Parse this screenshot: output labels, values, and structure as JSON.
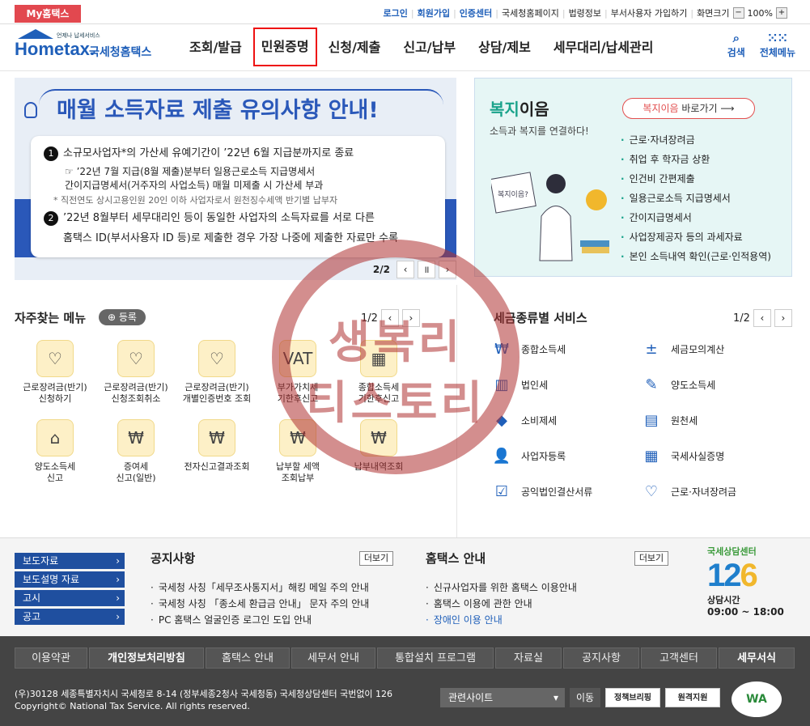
{
  "topbar": {
    "my_label": "My홈택스",
    "links": [
      "로그인",
      "회원가입",
      "인증센터",
      "국세청홈페이지",
      "법령정보",
      "부서사용자 가입하기",
      "화면크기"
    ],
    "zoom": "100%"
  },
  "header": {
    "logo_small": "언제나 납세서비스",
    "logo_main": "Hometax.",
    "logo_kr": "국세청홈택스",
    "nav": [
      "조회/발급",
      "민원증명",
      "신청/제출",
      "신고/납부",
      "상담/제보",
      "세무대리/납세관리"
    ],
    "search_label": "검색",
    "menu_label": "전체메뉴"
  },
  "banner": {
    "title": "매월 소득자료 제출 유의사항 안내!",
    "item1_num": "1",
    "item1": "소규모사업자*의 가산세 유예기간이 ’22년 6월 지급분까지로 종료",
    "item1_sub1": "’22년 7월 지급(8월 제출)분부터 일용근로소득 지급명세서",
    "item1_sub2": "간이지급명세서(거주자의 사업소득) 매월 미제출 시 가산세 부과",
    "item1_note": "* 직전연도 상시고용인원 20인 이하 사업자로서 원천징수세액 반기별 납부자",
    "item2_num": "2",
    "item2a": "’22년 8월부터 세무대리인 등이 동일한 사업자의 소득자료를 서로 다른",
    "item2b": "홈택스 ID(부서사용자 ID 등)로 제출한 경우 가장 나중에 제출한 자료만 수록",
    "page": "2/2"
  },
  "welfare": {
    "title_green": "복지",
    "title_rest": "이음",
    "subtitle": "소득과 복지를 연결하다!",
    "go_red": "복지이음",
    "go_rest": " 바로가기",
    "items": [
      "근로·자녀장려금",
      "취업 후 학자금 상환",
      "인건비 간편제출",
      "일용근로소득 지급명세서",
      "간이지급명세서",
      "사업장제공자 등의 과세자료",
      "본인 소득내역 확인(근로·인적용역)"
    ],
    "ill_text": "복지이음?"
  },
  "favorites": {
    "title": "자주찾는 메뉴",
    "register": "등록",
    "page": "1/2",
    "items": [
      {
        "label": "근로장려금(반기)\n신청하기",
        "icon": "♡"
      },
      {
        "label": "근로장려금(반기)\n신청조회취소",
        "icon": "♡"
      },
      {
        "label": "근로장려금(반기)\n개별인증번호 조회",
        "icon": "♡"
      },
      {
        "label": "부가가치세\n기한후신고",
        "icon": "VAT"
      },
      {
        "label": "종합소득세\n기한후신고",
        "icon": "▦"
      },
      {
        "label": "양도소득세\n신고",
        "icon": "⌂"
      },
      {
        "label": "증여세\n신고(일반)",
        "icon": "₩"
      },
      {
        "label": "전자신고결과조회",
        "icon": "₩"
      },
      {
        "label": "납부할 세액\n조회납부",
        "icon": "₩"
      },
      {
        "label": "납부내역조회",
        "icon": "₩"
      }
    ]
  },
  "taxservice": {
    "title": "세금종류별 서비스",
    "page": "1/2",
    "items": [
      {
        "label": "종합소득세",
        "icon": "₩"
      },
      {
        "label": "세금모의계산",
        "icon": "±"
      },
      {
        "label": "법인세",
        "icon": "▥"
      },
      {
        "label": "양도소득세",
        "icon": "✎"
      },
      {
        "label": "소비제세",
        "icon": "◆"
      },
      {
        "label": "원천세",
        "icon": "▤"
      },
      {
        "label": "사업자등록",
        "icon": "👤"
      },
      {
        "label": "국세사실증명",
        "icon": "▦"
      },
      {
        "label": "공익법인결산서류",
        "icon": "☑"
      },
      {
        "label": "근로·자녀장려금",
        "icon": "♡"
      }
    ]
  },
  "notice": {
    "side_buttons": [
      "보도자료",
      "보도설명 자료",
      "고시",
      "공고"
    ],
    "notice_title": "공지사항",
    "more": "더보기",
    "notices": [
      "국세청 사칭「세무조사통지서」해킹 메일 주의 안내",
      "국세청 사칭 「종소세 환급금 안내」 문자 주의 안내",
      "PC 홈택스 얼굴인증 로그인 도입 안내"
    ],
    "guide_title": "홈택스 안내",
    "guides": [
      "신규사업자를 위한 홈택스 이용안내",
      "홈택스 이용에 관한 안내",
      "장애인 이용 안내"
    ],
    "center_label": "국세상담센터",
    "center_num_a": "12",
    "center_num_b": "6",
    "hours_label": "상담시간",
    "hours": "09:00 ~ 18:00"
  },
  "footer": {
    "menu": [
      "이용약관",
      "개인정보처리방침",
      "홈택스 안내",
      "세무서 안내",
      "통합설치 프로그램",
      "자료실",
      "공지사항",
      "고객센터",
      "세무서식"
    ],
    "address": "(우)30128 세종특별자치시 국세청로 8-14 (정부세종2청사 국세청동) 국세청상담센터 국번없이 126",
    "copyright": "Copyright© National Tax Service. All rights reserved.",
    "related": "관련사이트",
    "move": "이동",
    "btn1": "정책브리핑",
    "btn2": "원격지원",
    "wa": "WA"
  },
  "stamp": {
    "line1": "생복리",
    "line2": "티스토리"
  }
}
